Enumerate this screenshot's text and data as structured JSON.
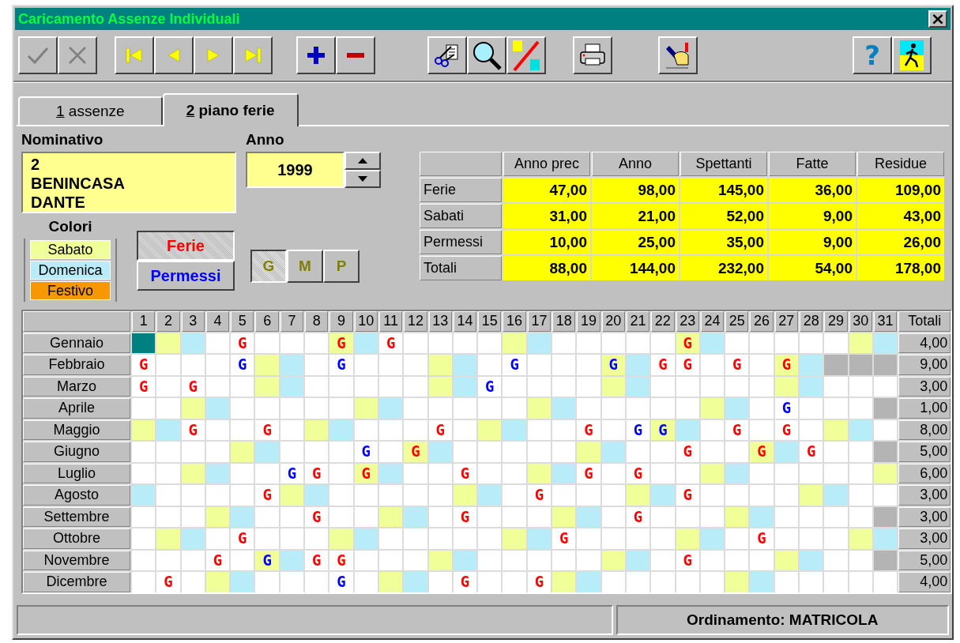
{
  "window": {
    "title": "Caricamento Assenze Individuali",
    "close": "×"
  },
  "toolbar": [
    [
      {
        "kind": "confirm",
        "disabled": true
      },
      {
        "kind": "cancel",
        "disabled": true
      }
    ],
    [
      {
        "kind": "first"
      },
      {
        "kind": "previous"
      },
      {
        "kind": "next"
      },
      {
        "kind": "last"
      }
    ],
    [
      {
        "kind": "add"
      },
      {
        "kind": "remove"
      }
    ],
    [
      {
        "kind": "cut"
      },
      {
        "kind": "search"
      },
      {
        "kind": "swap"
      }
    ],
    [
      {
        "kind": "print"
      }
    ],
    [
      {
        "kind": "edit"
      }
    ],
    [
      {
        "kind": "help",
        "label": "?"
      },
      {
        "kind": "exit"
      }
    ]
  ],
  "tabs": [
    {
      "key": "1",
      "label": "assenze",
      "selected": false
    },
    {
      "key": "2",
      "label": "piano ferie",
      "selected": true
    }
  ],
  "nominativo": {
    "label": "Nominativo",
    "lines": [
      "2",
      "BENINCASA",
      "DANTE"
    ]
  },
  "anno": {
    "label": "Anno",
    "value": "1999"
  },
  "colori": {
    "label": "Colori",
    "items": [
      {
        "label": "Sabato",
        "color": "#f0ff98"
      },
      {
        "label": "Domenica",
        "color": "#b8ecf8"
      },
      {
        "label": "Festivo",
        "color": "#f89800"
      }
    ]
  },
  "modes": [
    {
      "kind": "ferie",
      "label": "Ferie",
      "selected": true
    },
    {
      "kind": "permessi",
      "label": "Permessi",
      "selected": false
    }
  ],
  "units": [
    {
      "label": "G",
      "selected": true
    },
    {
      "label": "M",
      "selected": false
    },
    {
      "label": "P",
      "selected": false
    }
  ],
  "summary": {
    "columns": [
      "Anno prec",
      "Anno",
      "Spettanti",
      "Fatte",
      "Residue"
    ],
    "rows": [
      {
        "label": "Ferie",
        "values": [
          "47,00",
          "98,00",
          "145,00",
          "36,00",
          "109,00"
        ]
      },
      {
        "label": "Sabati",
        "values": [
          "31,00",
          "21,00",
          "52,00",
          "9,00",
          "43,00"
        ]
      },
      {
        "label": "Permessi",
        "values": [
          "10,00",
          "25,00",
          "35,00",
          "9,00",
          "26,00"
        ]
      },
      {
        "label": "Totali",
        "values": [
          "88,00",
          "144,00",
          "232,00",
          "54,00",
          "178,00"
        ]
      }
    ]
  },
  "calendar": {
    "columns": [
      "1",
      "2",
      "3",
      "4",
      "5",
      "6",
      "7",
      "8",
      "9",
      "10",
      "11",
      "12",
      "13",
      "14",
      "15",
      "16",
      "17",
      "18",
      "19",
      "20",
      "21",
      "22",
      "23",
      "24",
      "25",
      "26",
      "27",
      "28",
      "29",
      "30",
      "31"
    ],
    "total_header": "Totali",
    "months": [
      {
        "name": "Gennaio",
        "total": "4,00",
        "days": [
          {
            "kind": "cursor"
          },
          {
            "kind": "sat"
          },
          {
            "kind": "sun"
          },
          {
            "kind": "day"
          },
          {
            "kind": "day",
            "text": "G",
            "color": "#ff0000"
          },
          {
            "kind": "day"
          },
          {
            "kind": "day"
          },
          {
            "kind": "day"
          },
          {
            "kind": "sat",
            "text": "G",
            "color": "#ff0000"
          },
          {
            "kind": "sun"
          },
          {
            "kind": "day",
            "text": "G",
            "color": "#ff0000"
          },
          {
            "kind": "day"
          },
          {
            "kind": "day"
          },
          {
            "kind": "day"
          },
          {
            "kind": "day"
          },
          {
            "kind": "sat"
          },
          {
            "kind": "sun"
          },
          {
            "kind": "day"
          },
          {
            "kind": "day"
          },
          {
            "kind": "day"
          },
          {
            "kind": "day"
          },
          {
            "kind": "day"
          },
          {
            "kind": "sat",
            "text": "G",
            "color": "#ff0000"
          },
          {
            "kind": "sun"
          },
          {
            "kind": "day"
          },
          {
            "kind": "day"
          },
          {
            "kind": "day"
          },
          {
            "kind": "day"
          },
          {
            "kind": "day"
          },
          {
            "kind": "sat"
          },
          {
            "kind": "sun"
          }
        ]
      },
      {
        "name": "Febbraio",
        "total": "9,00",
        "days": [
          {
            "kind": "day",
            "text": "G",
            "color": "#ff0000"
          },
          {
            "kind": "day"
          },
          {
            "kind": "day"
          },
          {
            "kind": "day"
          },
          {
            "kind": "day",
            "text": "G",
            "color": "#0000ff"
          },
          {
            "kind": "sat"
          },
          {
            "kind": "sun"
          },
          {
            "kind": "day"
          },
          {
            "kind": "day",
            "text": "G",
            "color": "#0000ff"
          },
          {
            "kind": "day"
          },
          {
            "kind": "day"
          },
          {
            "kind": "day"
          },
          {
            "kind": "sat"
          },
          {
            "kind": "sun"
          },
          {
            "kind": "day"
          },
          {
            "kind": "day",
            "text": "G",
            "color": "#0000ff"
          },
          {
            "kind": "day"
          },
          {
            "kind": "day"
          },
          {
            "kind": "day"
          },
          {
            "kind": "sat",
            "text": "G",
            "color": "#0000ff"
          },
          {
            "kind": "sun"
          },
          {
            "kind": "day",
            "text": "G",
            "color": "#ff0000"
          },
          {
            "kind": "day",
            "text": "G",
            "color": "#ff0000"
          },
          {
            "kind": "day"
          },
          {
            "kind": "day",
            "text": "G",
            "color": "#ff0000"
          },
          {
            "kind": "day"
          },
          {
            "kind": "sat",
            "text": "G",
            "color": "#ff0000"
          },
          {
            "kind": "sun"
          },
          {
            "kind": "off"
          },
          {
            "kind": "off"
          },
          {
            "kind": "off"
          }
        ]
      },
      {
        "name": "Marzo",
        "total": "3,00",
        "days": [
          {
            "kind": "day",
            "text": "G",
            "color": "#ff0000"
          },
          {
            "kind": "day"
          },
          {
            "kind": "day",
            "text": "G",
            "color": "#ff0000"
          },
          {
            "kind": "day"
          },
          {
            "kind": "day"
          },
          {
            "kind": "sat"
          },
          {
            "kind": "sun"
          },
          {
            "kind": "day"
          },
          {
            "kind": "day"
          },
          {
            "kind": "day"
          },
          {
            "kind": "day"
          },
          {
            "kind": "day"
          },
          {
            "kind": "sat"
          },
          {
            "kind": "sun"
          },
          {
            "kind": "day",
            "text": "G",
            "color": "#0000ff"
          },
          {
            "kind": "day"
          },
          {
            "kind": "day"
          },
          {
            "kind": "day"
          },
          {
            "kind": "day"
          },
          {
            "kind": "sat"
          },
          {
            "kind": "sun"
          },
          {
            "kind": "day"
          },
          {
            "kind": "day"
          },
          {
            "kind": "day"
          },
          {
            "kind": "day"
          },
          {
            "kind": "day"
          },
          {
            "kind": "sat"
          },
          {
            "kind": "sun"
          },
          {
            "kind": "day"
          },
          {
            "kind": "day"
          },
          {
            "kind": "day"
          }
        ]
      },
      {
        "name": "Aprile",
        "total": "1,00",
        "days": [
          {
            "kind": "day"
          },
          {
            "kind": "day"
          },
          {
            "kind": "sat"
          },
          {
            "kind": "sun"
          },
          {
            "kind": "day"
          },
          {
            "kind": "day"
          },
          {
            "kind": "day"
          },
          {
            "kind": "day"
          },
          {
            "kind": "day"
          },
          {
            "kind": "sat"
          },
          {
            "kind": "sun"
          },
          {
            "kind": "day"
          },
          {
            "kind": "day"
          },
          {
            "kind": "day"
          },
          {
            "kind": "day"
          },
          {
            "kind": "day"
          },
          {
            "kind": "sat"
          },
          {
            "kind": "sun"
          },
          {
            "kind": "day"
          },
          {
            "kind": "day"
          },
          {
            "kind": "day"
          },
          {
            "kind": "day"
          },
          {
            "kind": "day"
          },
          {
            "kind": "sat"
          },
          {
            "kind": "sun"
          },
          {
            "kind": "day"
          },
          {
            "kind": "day",
            "text": "G",
            "color": "#0000ff"
          },
          {
            "kind": "day"
          },
          {
            "kind": "day"
          },
          {
            "kind": "day"
          },
          {
            "kind": "off"
          }
        ]
      },
      {
        "name": "Maggio",
        "total": "8,00",
        "days": [
          {
            "kind": "sat"
          },
          {
            "kind": "sun"
          },
          {
            "kind": "day",
            "text": "G",
            "color": "#ff0000"
          },
          {
            "kind": "day"
          },
          {
            "kind": "day"
          },
          {
            "kind": "day",
            "text": "G",
            "color": "#ff0000"
          },
          {
            "kind": "day"
          },
          {
            "kind": "sat"
          },
          {
            "kind": "sun"
          },
          {
            "kind": "day"
          },
          {
            "kind": "day"
          },
          {
            "kind": "day"
          },
          {
            "kind": "day",
            "text": "G",
            "color": "#ff0000"
          },
          {
            "kind": "day"
          },
          {
            "kind": "sat"
          },
          {
            "kind": "sun"
          },
          {
            "kind": "day"
          },
          {
            "kind": "day"
          },
          {
            "kind": "day",
            "text": "G",
            "color": "#ff0000"
          },
          {
            "kind": "day"
          },
          {
            "kind": "day",
            "text": "G",
            "color": "#0000ff"
          },
          {
            "kind": "sat",
            "text": "G",
            "color": "#0000ff"
          },
          {
            "kind": "sun"
          },
          {
            "kind": "day"
          },
          {
            "kind": "day",
            "text": "G",
            "color": "#ff0000"
          },
          {
            "kind": "day"
          },
          {
            "kind": "day",
            "text": "G",
            "color": "#ff0000"
          },
          {
            "kind": "day"
          },
          {
            "kind": "sat"
          },
          {
            "kind": "sun"
          },
          {
            "kind": "day"
          }
        ]
      },
      {
        "name": "Giugno",
        "total": "5,00",
        "days": [
          {
            "kind": "day"
          },
          {
            "kind": "day"
          },
          {
            "kind": "day"
          },
          {
            "kind": "day"
          },
          {
            "kind": "sat"
          },
          {
            "kind": "sun"
          },
          {
            "kind": "day"
          },
          {
            "kind": "day"
          },
          {
            "kind": "day"
          },
          {
            "kind": "day",
            "text": "G",
            "color": "#0000ff"
          },
          {
            "kind": "day"
          },
          {
            "kind": "sat",
            "text": "G",
            "color": "#ff0000"
          },
          {
            "kind": "sun"
          },
          {
            "kind": "day"
          },
          {
            "kind": "day"
          },
          {
            "kind": "day"
          },
          {
            "kind": "day"
          },
          {
            "kind": "day"
          },
          {
            "kind": "sat"
          },
          {
            "kind": "sun"
          },
          {
            "kind": "day"
          },
          {
            "kind": "day"
          },
          {
            "kind": "day",
            "text": "G",
            "color": "#ff0000"
          },
          {
            "kind": "day"
          },
          {
            "kind": "day"
          },
          {
            "kind": "sat",
            "text": "G",
            "color": "#ff0000"
          },
          {
            "kind": "sun"
          },
          {
            "kind": "day",
            "text": "G",
            "color": "#ff0000"
          },
          {
            "kind": "day"
          },
          {
            "kind": "day"
          },
          {
            "kind": "off"
          }
        ]
      },
      {
        "name": "Luglio",
        "total": "6,00",
        "days": [
          {
            "kind": "day"
          },
          {
            "kind": "day"
          },
          {
            "kind": "sat"
          },
          {
            "kind": "sun"
          },
          {
            "kind": "day"
          },
          {
            "kind": "day"
          },
          {
            "kind": "day",
            "text": "G",
            "color": "#0000ff"
          },
          {
            "kind": "day",
            "text": "G",
            "color": "#ff0000"
          },
          {
            "kind": "day"
          },
          {
            "kind": "sat",
            "text": "G",
            "color": "#ff0000"
          },
          {
            "kind": "sun"
          },
          {
            "kind": "day"
          },
          {
            "kind": "day"
          },
          {
            "kind": "day",
            "text": "G",
            "color": "#ff0000"
          },
          {
            "kind": "day"
          },
          {
            "kind": "day"
          },
          {
            "kind": "sat"
          },
          {
            "kind": "sun"
          },
          {
            "kind": "day",
            "text": "G",
            "color": "#ff0000"
          },
          {
            "kind": "day"
          },
          {
            "kind": "day",
            "text": "G",
            "color": "#ff0000"
          },
          {
            "kind": "day"
          },
          {
            "kind": "day"
          },
          {
            "kind": "sat"
          },
          {
            "kind": "sun"
          },
          {
            "kind": "day"
          },
          {
            "kind": "day"
          },
          {
            "kind": "day"
          },
          {
            "kind": "day"
          },
          {
            "kind": "day"
          },
          {
            "kind": "sat"
          }
        ]
      },
      {
        "name": "Agosto",
        "total": "3,00",
        "days": [
          {
            "kind": "sun"
          },
          {
            "kind": "day"
          },
          {
            "kind": "day"
          },
          {
            "kind": "day"
          },
          {
            "kind": "day"
          },
          {
            "kind": "day",
            "text": "G",
            "color": "#ff0000"
          },
          {
            "kind": "sat"
          },
          {
            "kind": "sun"
          },
          {
            "kind": "day"
          },
          {
            "kind": "day"
          },
          {
            "kind": "day"
          },
          {
            "kind": "day"
          },
          {
            "kind": "day"
          },
          {
            "kind": "sat"
          },
          {
            "kind": "sun"
          },
          {
            "kind": "day"
          },
          {
            "kind": "day",
            "text": "G",
            "color": "#ff0000"
          },
          {
            "kind": "day"
          },
          {
            "kind": "day"
          },
          {
            "kind": "day"
          },
          {
            "kind": "sat"
          },
          {
            "kind": "sun"
          },
          {
            "kind": "day",
            "text": "G",
            "color": "#ff0000"
          },
          {
            "kind": "day"
          },
          {
            "kind": "day"
          },
          {
            "kind": "day"
          },
          {
            "kind": "day"
          },
          {
            "kind": "sat"
          },
          {
            "kind": "sun"
          },
          {
            "kind": "day"
          },
          {
            "kind": "day"
          }
        ]
      },
      {
        "name": "Settembre",
        "total": "3,00",
        "days": [
          {
            "kind": "day"
          },
          {
            "kind": "day"
          },
          {
            "kind": "day"
          },
          {
            "kind": "sat"
          },
          {
            "kind": "sun"
          },
          {
            "kind": "day"
          },
          {
            "kind": "day"
          },
          {
            "kind": "day",
            "text": "G",
            "color": "#ff0000"
          },
          {
            "kind": "day"
          },
          {
            "kind": "day"
          },
          {
            "kind": "sat"
          },
          {
            "kind": "sun"
          },
          {
            "kind": "day"
          },
          {
            "kind": "day",
            "text": "G",
            "color": "#ff0000"
          },
          {
            "kind": "day"
          },
          {
            "kind": "day"
          },
          {
            "kind": "day"
          },
          {
            "kind": "sat"
          },
          {
            "kind": "sun"
          },
          {
            "kind": "day"
          },
          {
            "kind": "day",
            "text": "G",
            "color": "#ff0000"
          },
          {
            "kind": "day"
          },
          {
            "kind": "day"
          },
          {
            "kind": "day"
          },
          {
            "kind": "sat"
          },
          {
            "kind": "sun"
          },
          {
            "kind": "day"
          },
          {
            "kind": "day"
          },
          {
            "kind": "day"
          },
          {
            "kind": "day"
          },
          {
            "kind": "off"
          }
        ]
      },
      {
        "name": "Ottobre",
        "total": "3,00",
        "days": [
          {
            "kind": "day"
          },
          {
            "kind": "sat"
          },
          {
            "kind": "sun"
          },
          {
            "kind": "day"
          },
          {
            "kind": "day",
            "text": "G",
            "color": "#ff0000"
          },
          {
            "kind": "day"
          },
          {
            "kind": "day"
          },
          {
            "kind": "day"
          },
          {
            "kind": "sat"
          },
          {
            "kind": "sun"
          },
          {
            "kind": "day"
          },
          {
            "kind": "day"
          },
          {
            "kind": "day"
          },
          {
            "kind": "day"
          },
          {
            "kind": "day"
          },
          {
            "kind": "sat"
          },
          {
            "kind": "sun"
          },
          {
            "kind": "day",
            "text": "G",
            "color": "#ff0000"
          },
          {
            "kind": "day"
          },
          {
            "kind": "day"
          },
          {
            "kind": "day"
          },
          {
            "kind": "day"
          },
          {
            "kind": "sat"
          },
          {
            "kind": "sun"
          },
          {
            "kind": "day"
          },
          {
            "kind": "day",
            "text": "G",
            "color": "#ff0000"
          },
          {
            "kind": "day"
          },
          {
            "kind": "day"
          },
          {
            "kind": "day"
          },
          {
            "kind": "sat"
          },
          {
            "kind": "sun"
          }
        ]
      },
      {
        "name": "Novembre",
        "total": "5,00",
        "days": [
          {
            "kind": "day"
          },
          {
            "kind": "day"
          },
          {
            "kind": "day"
          },
          {
            "kind": "day",
            "text": "G",
            "color": "#ff0000"
          },
          {
            "kind": "day"
          },
          {
            "kind": "sat",
            "text": "G",
            "color": "#0000ff"
          },
          {
            "kind": "sun"
          },
          {
            "kind": "day",
            "text": "G",
            "color": "#ff0000"
          },
          {
            "kind": "day",
            "text": "G",
            "color": "#ff0000"
          },
          {
            "kind": "day"
          },
          {
            "kind": "day"
          },
          {
            "kind": "day"
          },
          {
            "kind": "sat"
          },
          {
            "kind": "sun"
          },
          {
            "kind": "day"
          },
          {
            "kind": "day"
          },
          {
            "kind": "day"
          },
          {
            "kind": "day"
          },
          {
            "kind": "day"
          },
          {
            "kind": "sat"
          },
          {
            "kind": "sun"
          },
          {
            "kind": "day"
          },
          {
            "kind": "day",
            "text": "G",
            "color": "#ff0000"
          },
          {
            "kind": "day"
          },
          {
            "kind": "day"
          },
          {
            "kind": "day"
          },
          {
            "kind": "sat"
          },
          {
            "kind": "sun"
          },
          {
            "kind": "day"
          },
          {
            "kind": "day"
          },
          {
            "kind": "off"
          }
        ]
      },
      {
        "name": "Dicembre",
        "total": "4,00",
        "days": [
          {
            "kind": "day"
          },
          {
            "kind": "day",
            "text": "G",
            "color": "#ff0000"
          },
          {
            "kind": "day"
          },
          {
            "kind": "sat"
          },
          {
            "kind": "sun"
          },
          {
            "kind": "day"
          },
          {
            "kind": "day"
          },
          {
            "kind": "day"
          },
          {
            "kind": "day",
            "text": "G",
            "color": "#0000ff"
          },
          {
            "kind": "day"
          },
          {
            "kind": "sat"
          },
          {
            "kind": "sun"
          },
          {
            "kind": "day"
          },
          {
            "kind": "day",
            "text": "G",
            "color": "#ff0000"
          },
          {
            "kind": "day"
          },
          {
            "kind": "day"
          },
          {
            "kind": "day",
            "text": "G",
            "color": "#ff0000"
          },
          {
            "kind": "sat"
          },
          {
            "kind": "sun"
          },
          {
            "kind": "day"
          },
          {
            "kind": "day"
          },
          {
            "kind": "day"
          },
          {
            "kind": "day"
          },
          {
            "kind": "day"
          },
          {
            "kind": "sat"
          },
          {
            "kind": "sun"
          },
          {
            "kind": "day"
          },
          {
            "kind": "day"
          },
          {
            "kind": "day"
          },
          {
            "kind": "day"
          },
          {
            "kind": "day"
          }
        ]
      }
    ]
  },
  "status_bar": {
    "text": "Ordinamento: MATRICOLA"
  }
}
